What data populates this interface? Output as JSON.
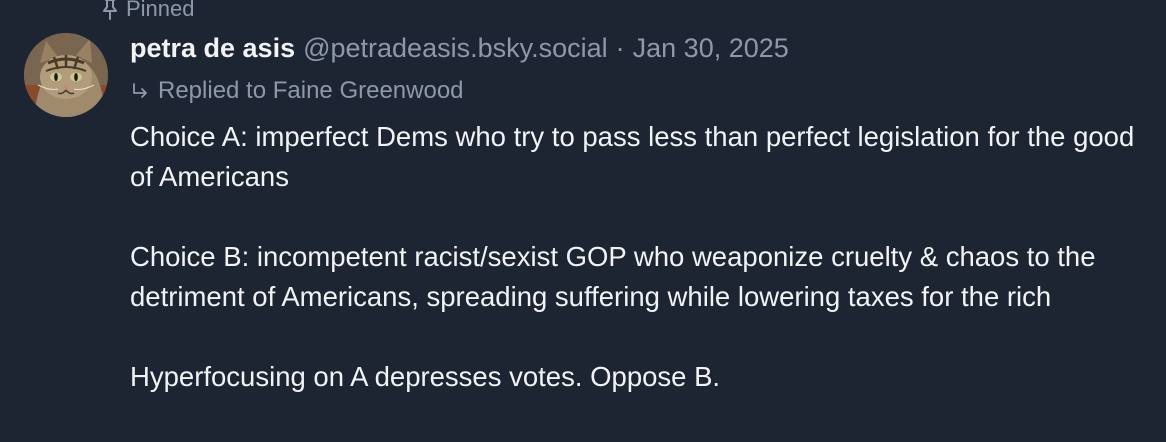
{
  "pinned": {
    "label": "Pinned",
    "icon": "pin-icon"
  },
  "author": {
    "display_name": "petra de asis",
    "handle": "@petradeasis.bsky.social",
    "separator": "·",
    "timestamp": "Jan 30, 2025",
    "avatar_icon": "cat-avatar"
  },
  "reply": {
    "label": "Replied to Faine Greenwood",
    "icon": "reply-arrow-icon"
  },
  "body": {
    "paragraphs": [
      "Choice A: imperfect Dems who try to pass less than perfect legislation for the good of Americans",
      "Choice B: incompetent racist/sexist GOP who weaponize cruelty & chaos to the detriment of Americans, spreading suffering while lowering taxes for the rich",
      "Hyperfocusing on A depresses votes. Oppose B."
    ]
  },
  "colors": {
    "background": "#1d2532",
    "primary_text": "#f1f3f5",
    "secondary_text": "#8d99ab"
  }
}
